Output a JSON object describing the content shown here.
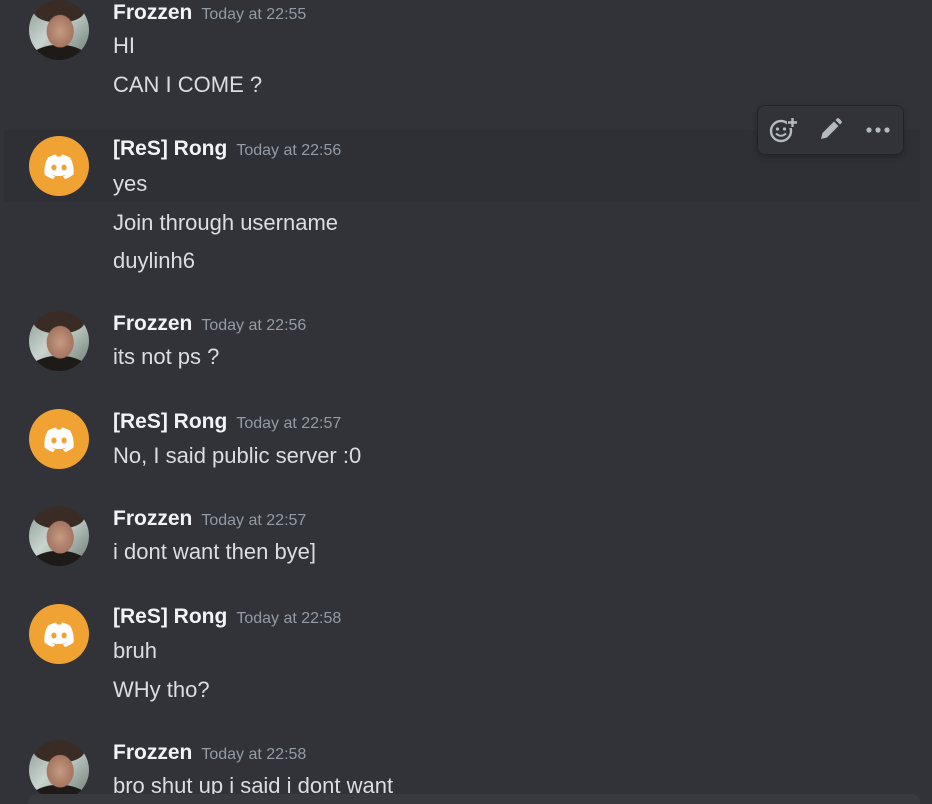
{
  "messages": [
    {
      "author": "Frozzen",
      "avatar": "user-photo-avatar",
      "timestamp": "Today at 22:55",
      "lines": [
        "HI",
        "CAN I COME ?"
      ]
    },
    {
      "author": "[ReS] Rong",
      "avatar": "discord-default-avatar",
      "timestamp": "Today at 22:56",
      "lines": [
        "yes",
        "Join through username",
        "duylinh6"
      ]
    },
    {
      "author": "Frozzen",
      "avatar": "user-photo-avatar",
      "timestamp": "Today at 22:56",
      "lines": [
        "its not ps ?"
      ]
    },
    {
      "author": "[ReS] Rong",
      "avatar": "discord-default-avatar",
      "timestamp": "Today at 22:57",
      "lines": [
        "No, I said public server :0"
      ]
    },
    {
      "author": "Frozzen",
      "avatar": "user-photo-avatar",
      "timestamp": "Today at 22:57",
      "lines": [
        "i dont want then bye]"
      ]
    },
    {
      "author": "[ReS] Rong",
      "avatar": "discord-default-avatar",
      "timestamp": "Today at 22:58",
      "lines": [
        "bruh",
        "WHy tho?"
      ]
    },
    {
      "author": "Frozzen",
      "avatar": "user-photo-avatar",
      "timestamp": "Today at 22:58",
      "lines": [
        "bro shut up i said i dont want"
      ]
    }
  ],
  "toolbar": {
    "icons": [
      "add-reaction-icon",
      "edit-pencil-icon",
      "more-options-icon"
    ]
  },
  "colors": {
    "background": "#313338",
    "hover_background": "#2e3035",
    "author": "#f2f3f5",
    "timestamp": "#949ba4",
    "text": "#dbdee1",
    "discord_avatar": "#f0a232"
  }
}
